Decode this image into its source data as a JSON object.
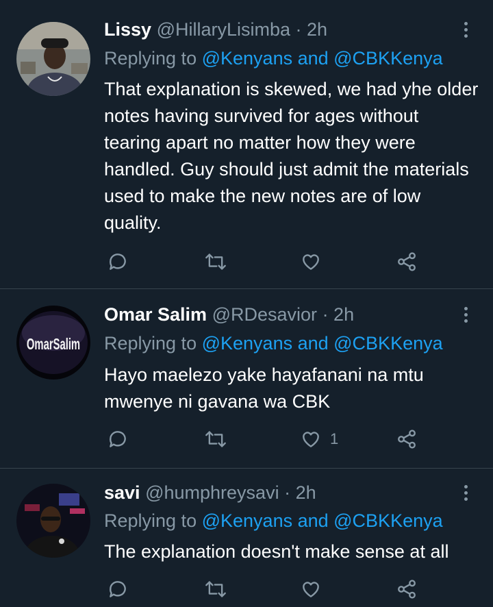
{
  "tweets": [
    {
      "name": "Lissy",
      "handle": "@HillaryLisimba",
      "time": "· 2h",
      "replying_prefix": "Replying to",
      "mentions": "@Kenyans and @CBKKenya",
      "text": "That explanation is skewed,  we had yhe older notes having survived for ages without tearing apart no matter how they were handled. Guy should just admit the materials used to make the new notes are of low quality.",
      "like_count": ""
    },
    {
      "name": "Omar Salim",
      "handle": "@RDesavior",
      "time": "· 2h",
      "replying_prefix": "Replying to",
      "mentions": "@Kenyans and @CBKKenya",
      "text": "Hayo maelezo yake hayafanani na mtu mwenye ni gavana wa CBK",
      "like_count": "1",
      "avatar_text": "OmarSalim"
    },
    {
      "name": "savi",
      "handle": "@humphreysavi",
      "time": "· 2h",
      "replying_prefix": "Replying to",
      "mentions": "@Kenyans and @CBKKenya",
      "text": "The explanation doesn't make sense at all",
      "like_count": ""
    }
  ],
  "colors": {
    "background": "#15202b",
    "divider": "#38444d",
    "secondary_text": "#8899a6",
    "link": "#1da1f2"
  },
  "icons": [
    "more-vertical-icon",
    "reply-icon",
    "retweet-icon",
    "like-icon",
    "share-icon"
  ]
}
